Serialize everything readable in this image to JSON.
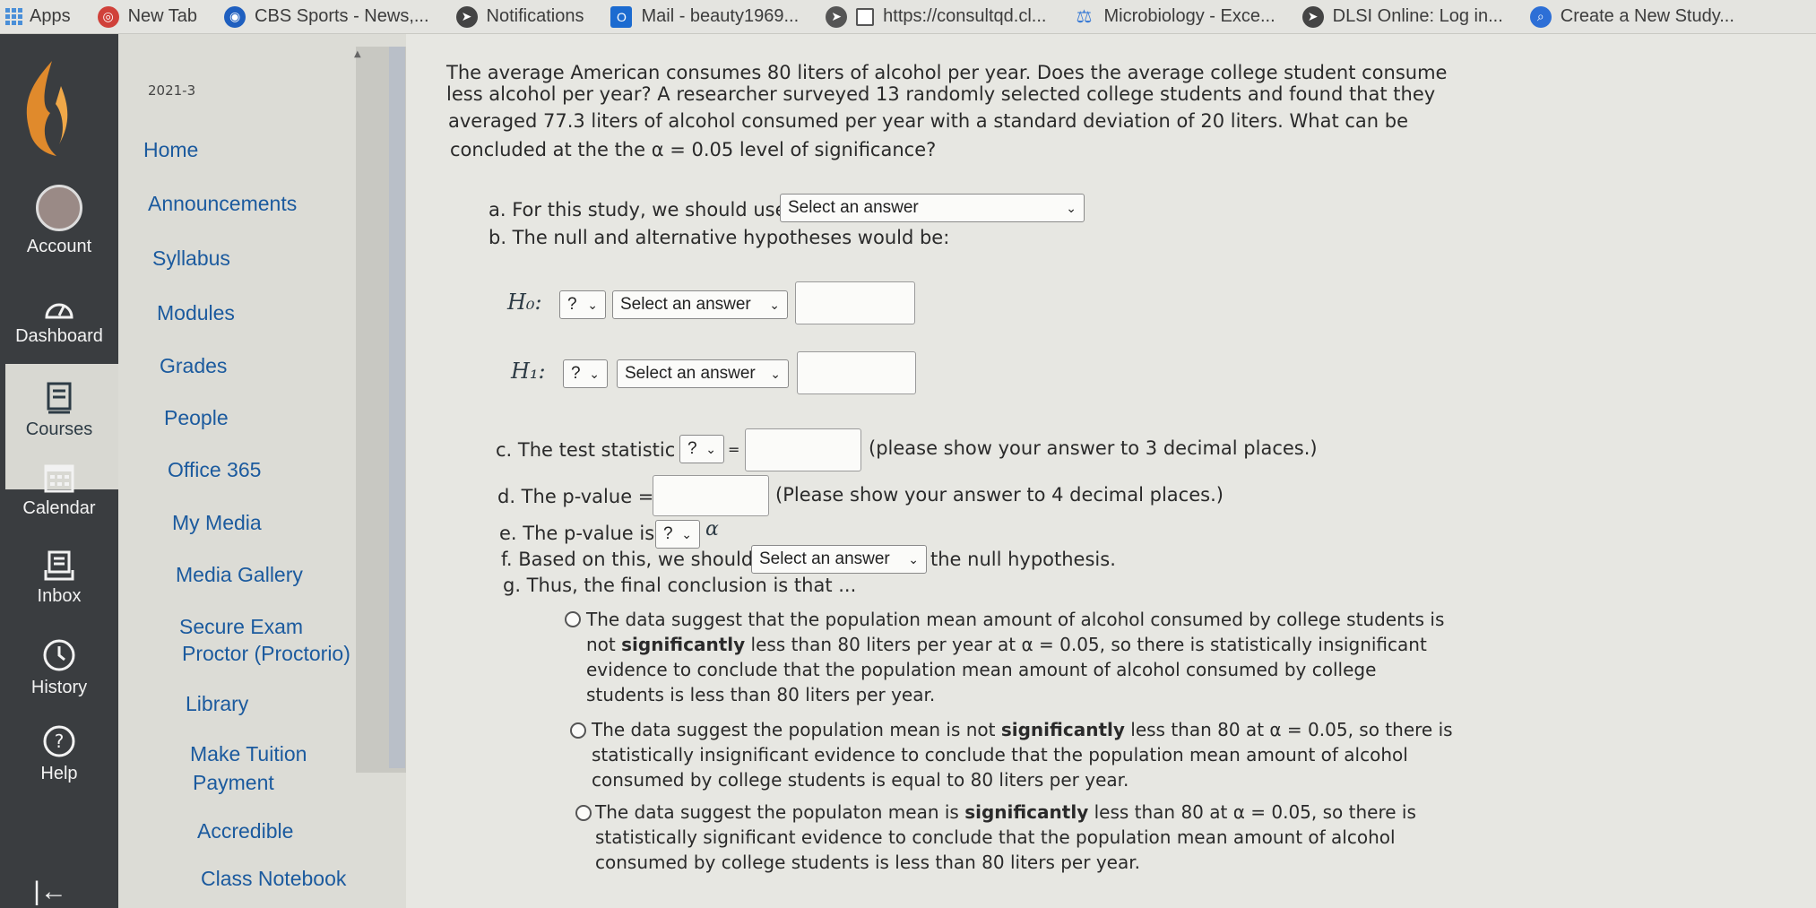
{
  "bookmarks": [
    {
      "label": "Apps",
      "icon": "apps-grid-icon",
      "color": "#4a8fd8"
    },
    {
      "label": "New Tab",
      "icon": "newtab-icon",
      "color": "#d0413a"
    },
    {
      "label": "CBS Sports - News,...",
      "icon": "cbs-icon",
      "color": "#1f5fbf"
    },
    {
      "label": "Notifications",
      "icon": "notifications-icon",
      "color": "#444444"
    },
    {
      "label": "Mail - beauty1969...",
      "icon": "mail-icon",
      "color": "#1c6bd0"
    },
    {
      "label": "https://consultqd.cl...",
      "icon": "page-icon",
      "color": "#555555"
    },
    {
      "label": "Microbiology - Exce...",
      "icon": "scale-icon",
      "color": "#3a7bd5"
    },
    {
      "label": "DLSI Online: Log in...",
      "icon": "globe-icon",
      "color": "#444444"
    },
    {
      "label": "Create a New Study...",
      "icon": "search-icon",
      "color": "#2d6fd6"
    }
  ],
  "global_nav": {
    "account": "Account",
    "dashboard": "Dashboard",
    "courses": "Courses",
    "calendar": "Calendar",
    "inbox": "Inbox",
    "history": "History",
    "help": "Help",
    "collapse": "|←"
  },
  "course_nav": {
    "term": "2021-3",
    "links": [
      "Home",
      "Announcements",
      "Syllabus",
      "Modules",
      "Grades",
      "People",
      "Office 365",
      "My Media",
      "Media Gallery",
      "Secure Exam",
      "Proctor (Proctorio)",
      "Library",
      "Make Tuition",
      "Payment",
      "Accredible",
      "Class Notebook"
    ]
  },
  "question": {
    "lines": [
      "The average American consumes 80 liters of alcohol per year. Does the average college student consume",
      "less alcohol per year? A researcher surveyed 13 randomly selected college students and found that they",
      "averaged 77.3 liters of alcohol consumed per year with a standard deviation of 20 liters. What can be",
      "concluded at the the α = 0.05 level of significance?"
    ],
    "a_label": "a. For this study, we should use",
    "a_select": "Select an answer",
    "b_label": "b. The null and alternative hypotheses would be:",
    "h0": "H₀:",
    "h1": "H₁:",
    "q_select": "?",
    "ans_select": "Select an answer",
    "c_label": "c. The test statistic",
    "c_equals": "=",
    "c_note": "(please show your answer to 3 decimal places.)",
    "d_label": "d. The p-value =",
    "d_note": "(Please show your answer to 4 decimal places.)",
    "e_label": "e. The p-value is",
    "e_alpha": "α",
    "f_label": "f. Based on this, we should",
    "f_select": "Select an answer",
    "f_after": "the null hypothesis.",
    "g_label": "g. Thus, the final conclusion is that ...",
    "opt1": [
      "The data suggest that the population mean amount of alcohol consumed by college students is",
      "not ",
      "significantly",
      " less than 80 liters per year at α = 0.05, so there is statistically insignificant",
      "evidence to conclude that the population mean amount of alcohol consumed by college",
      "students is less than 80 liters per year."
    ],
    "opt2": [
      "The data suggest the population mean is not ",
      "significantly",
      " less than 80 at α = 0.05, so there is",
      "statistically insignificant evidence to conclude that the population mean amount of alcohol",
      "consumed by college students is equal to 80 liters per year."
    ],
    "opt3": [
      "The data suggest the populaton mean is ",
      "significantly",
      " less than 80 at α = 0.05, so there is",
      "statistically significant evidence to conclude that the population mean amount of alcohol",
      "consumed by college students is less than 80 liters per year."
    ]
  }
}
